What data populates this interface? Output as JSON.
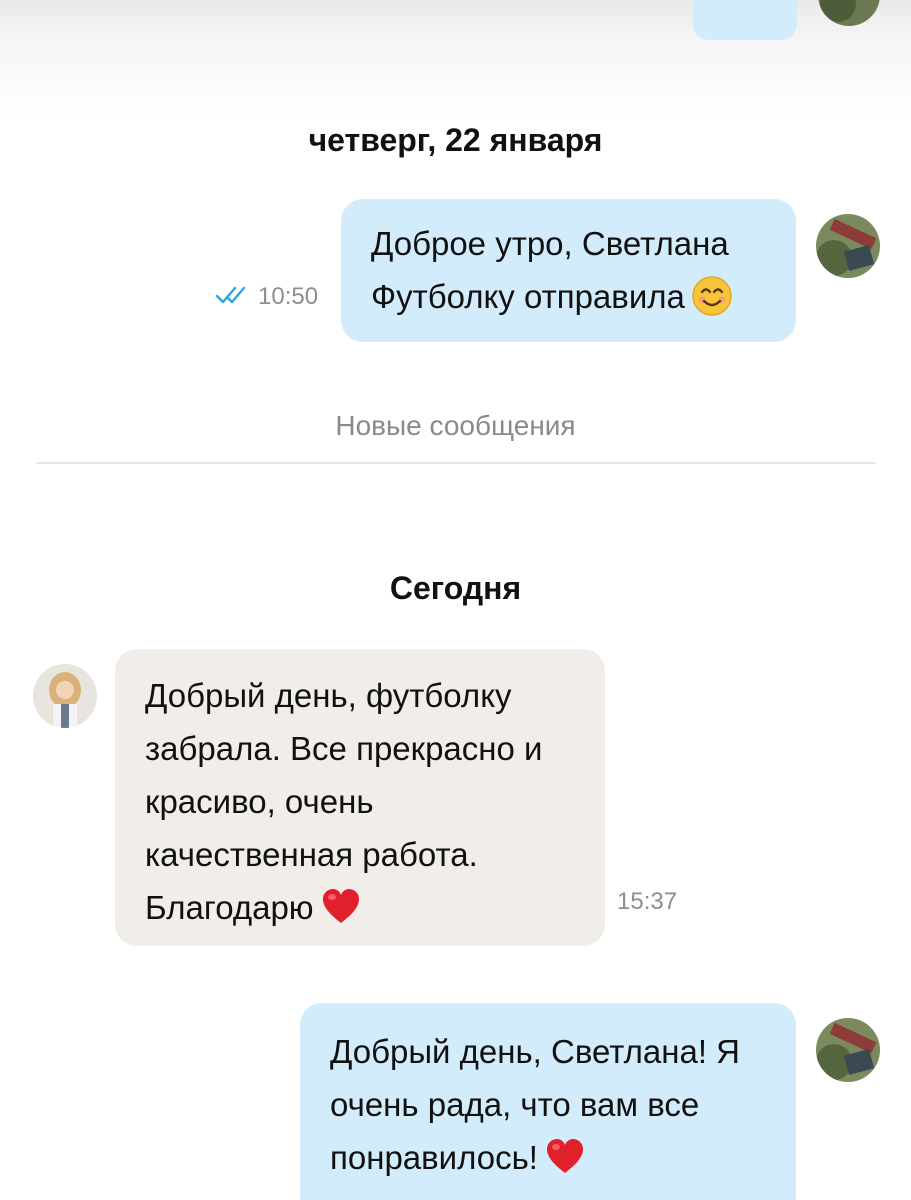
{
  "chat": {
    "dates": {
      "previous": "четверг, 22 января",
      "today": "Сегодня"
    },
    "new_messages_label": "Новые сообщения",
    "messages": [
      {
        "direction": "outgoing",
        "lines": [
          "Доброе утро, Светлана",
          "Футболку отправила"
        ],
        "trailing_emoji": "smiling-face",
        "time": "10:50",
        "status": "read"
      },
      {
        "direction": "incoming",
        "lines": [
          "Добрый день, футболку",
          "забрала. Все прекрасно и",
          "красиво, очень",
          "качественная работа.",
          "Благодарю"
        ],
        "trailing_emoji": "red-heart",
        "time": "15:37"
      },
      {
        "direction": "outgoing",
        "lines": [
          "Добрый день, Светлана! Я",
          "очень рада, что вам все",
          "понравилось!"
        ],
        "trailing_emoji": "red-heart"
      }
    ]
  },
  "colors": {
    "outgoing_bubble": "#d3ecfb",
    "incoming_bubble": "#f1eeea",
    "read_check": "#2aa3e8",
    "heart": "#e0202b"
  },
  "icons": {
    "read_status": "double-check-icon",
    "avatar_self": "avatar-icon",
    "avatar_contact": "avatar-icon"
  }
}
